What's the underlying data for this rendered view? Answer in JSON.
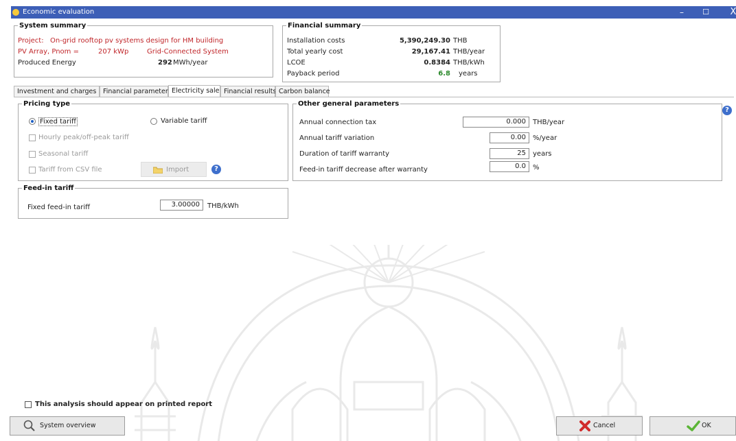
{
  "window": {
    "title": "Economic evaluation",
    "minimize": "–",
    "maximize": "☐",
    "close": "X"
  },
  "system_summary": {
    "legend": "System summary",
    "project_label": "Project:",
    "project_value": "On-grid rooftop pv systems design for HM building",
    "pv_label": "PV Array, Pnom =",
    "pv_value": "207 kWp",
    "system_type": "Grid-Connected System",
    "energy_label": "Produced Energy",
    "energy_value": "292",
    "energy_unit": "MWh/year"
  },
  "financial_summary": {
    "legend": "Financial summary",
    "rows": [
      {
        "label": "Installation costs",
        "value": "5,390,249.30",
        "unit": "THB"
      },
      {
        "label": "Total yearly cost",
        "value": "29,167.41",
        "unit": "THB/year"
      },
      {
        "label": "LCOE",
        "value": "0.8384",
        "unit": "THB/kWh"
      },
      {
        "label": "Payback period",
        "value": "6.8",
        "unit": "years"
      }
    ]
  },
  "tabs": [
    {
      "label": "Investment and charges"
    },
    {
      "label": "Financial parameters"
    },
    {
      "label": "Electricity sale"
    },
    {
      "label": "Financial results"
    },
    {
      "label": "Carbon balance"
    }
  ],
  "active_tab": "Electricity sale",
  "pricing_type": {
    "legend": "Pricing type",
    "fixed_tariff": "Fixed tariff",
    "variable_tariff": "Variable tariff",
    "hourly": "Hourly peak/off-peak tariff",
    "seasonal": "Seasonal tariff",
    "csv": "Tariff from CSV file",
    "import_label": "Import"
  },
  "feed_in": {
    "legend": "Feed-in tariff",
    "label": "Fixed feed-in tariff",
    "value": "3.00000",
    "unit": "THB/kWh"
  },
  "other_params": {
    "legend": "Other general parameters",
    "rows": [
      {
        "label": "Annual connection tax",
        "value": "0.000",
        "unit": "THB/year"
      },
      {
        "label": "Annual tariff variation",
        "value": "0.00",
        "unit": "%/year"
      },
      {
        "label": "Duration of tariff warranty",
        "value": "25",
        "unit": "years"
      },
      {
        "label": "Feed-in tariff decrease after warranty",
        "value": "0.0",
        "unit": "%"
      }
    ]
  },
  "print_option": "This analysis should appear on printed report",
  "buttons": {
    "overview": "System overview",
    "cancel": "Cancel",
    "ok": "OK"
  },
  "icons": [
    "app-icon",
    "help-icon",
    "folder-icon",
    "search-icon",
    "cancel-x-icon",
    "checkmark-icon"
  ],
  "colors": {
    "titlebar": "#3d5fb7",
    "project_text": "#c0262a",
    "payback": "#2c8a2c",
    "help": "#3e6fcc"
  }
}
